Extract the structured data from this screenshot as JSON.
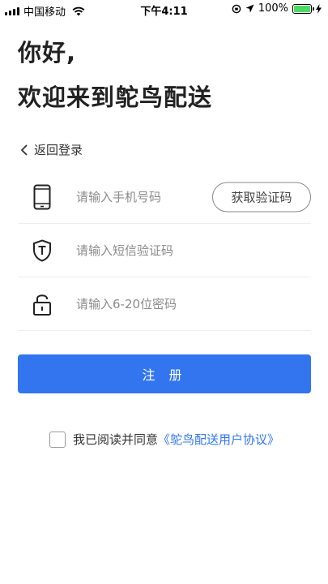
{
  "status_bar": {
    "carrier": "中国移动",
    "time": "下午4:11",
    "battery": "100%",
    "battery_level": 1.0
  },
  "header": {
    "greeting": "你好,",
    "welcome": "欢迎来到鸵鸟配送"
  },
  "back_link": {
    "label": "返回登录"
  },
  "form": {
    "phone": {
      "placeholder": "请输入手机号码",
      "value": "",
      "icon": "phone-icon"
    },
    "get_code_label": "获取验证码",
    "sms_code": {
      "placeholder": "请输入短信验证码",
      "value": "",
      "icon": "shield-icon"
    },
    "password": {
      "placeholder": "请输入6-20位密码",
      "value": "",
      "icon": "lock-icon"
    }
  },
  "register_label": "注 册",
  "agreement": {
    "prefix": "我已阅读并同意",
    "link": "《鸵鸟配送用户协议》",
    "checked": false
  },
  "colors": {
    "accent": "#3275ee",
    "battery_green": "#4cd964"
  }
}
